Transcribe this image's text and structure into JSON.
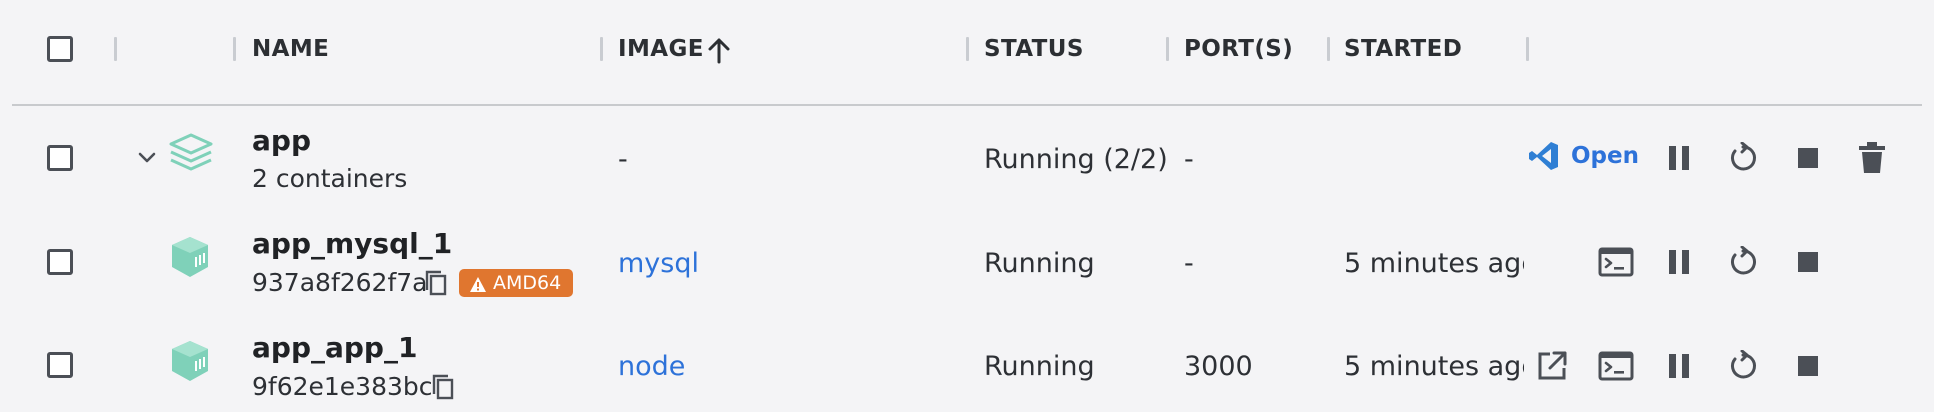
{
  "header": {
    "name": "NAME",
    "image": "IMAGE",
    "status": "STATUS",
    "ports": "PORT(S)",
    "started": "STARTED",
    "sort_icon": "arrow-up-icon"
  },
  "rows": [
    {
      "name": "app",
      "sub": "2 containers",
      "image": "-",
      "status": "Running (2/2)",
      "ports": "-",
      "started": "",
      "open_label": "Open",
      "icons": [
        "chevron-down-icon",
        "stack-icon",
        "vscode-icon",
        "pause-icon",
        "restart-icon",
        "stop-icon",
        "trash-icon"
      ]
    },
    {
      "name": "app_mysql_1",
      "sub": "937a8f262f7a",
      "badge": "AMD64",
      "image": "mysql",
      "status": "Running",
      "ports": "-",
      "started": "5 minutes agc",
      "icons": [
        "container-icon",
        "copy-icon",
        "warning-icon",
        "terminal-icon",
        "pause-icon",
        "restart-icon",
        "stop-icon"
      ]
    },
    {
      "name": "app_app_1",
      "sub": "9f62e1e383bc",
      "image": "node",
      "status": "Running",
      "ports": "3000",
      "started": "5 minutes agc",
      "icons": [
        "container-icon",
        "copy-icon",
        "external-link-icon",
        "terminal-icon",
        "pause-icon",
        "restart-icon",
        "stop-icon"
      ]
    }
  ],
  "colors": {
    "accent": "#2d72d9",
    "badge": "#e0762f",
    "container_icon": "#7fd1b9",
    "vscode": "#2f7fd4"
  }
}
